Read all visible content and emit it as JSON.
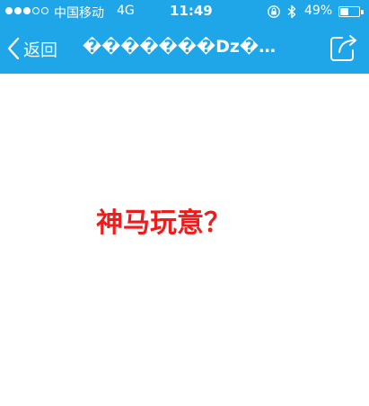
{
  "status_bar": {
    "carrier": "中国移动",
    "network": "4G",
    "time": "11:49",
    "battery_percent_label": "49%",
    "battery_level": 0.49,
    "signal_bars": 3,
    "signal_total": 5
  },
  "nav": {
    "back_label": "返回",
    "title": "�������Dz������...",
    "icons": {
      "back": "chevron-left-icon",
      "share": "share-icon"
    }
  },
  "content": {
    "message": "神马玩意？"
  },
  "colors": {
    "header_bg": "#1fa6e8",
    "message_text": "#ee1c1c",
    "content_bg": "#ffffff"
  }
}
